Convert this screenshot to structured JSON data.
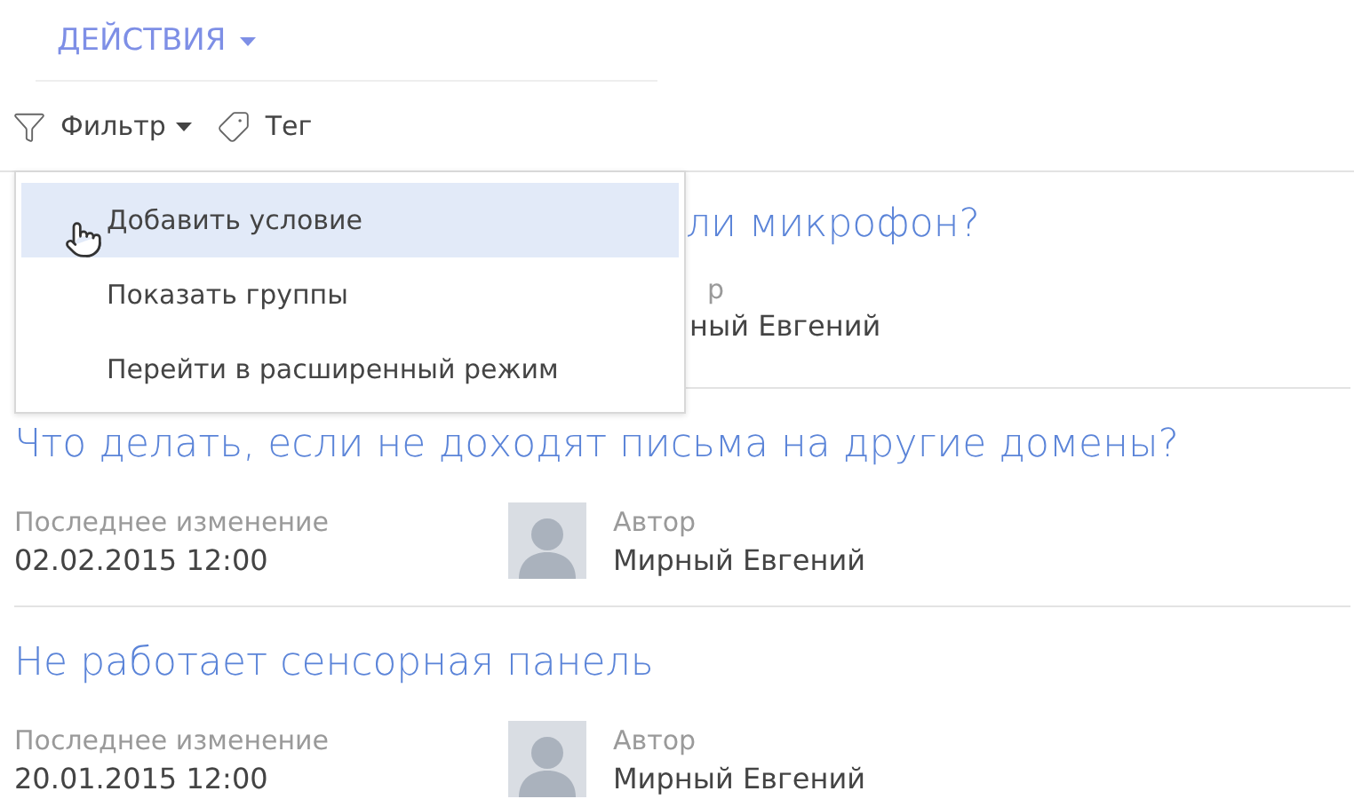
{
  "actions_menu": {
    "label": "ДЕЙСТВИЯ"
  },
  "toolbar": {
    "filter": "Фильтр",
    "tag": "Тег"
  },
  "filter_menu": {
    "items": [
      {
        "label": "Добавить условие",
        "selected": true
      },
      {
        "label": "Показать группы",
        "selected": false
      },
      {
        "label": "Перейти в расширенный режим",
        "selected": false
      }
    ]
  },
  "records": [
    {
      "kind": "covered",
      "title": "ли микрофон?",
      "author_label": "р",
      "author": "ный Евгений"
    },
    {
      "kind": "full",
      "title": "Что делать, если не доходят письма на другие домены?",
      "modified_label": "Последнее изменение",
      "modified": "02.02.2015 12:00",
      "author_label": "Автор",
      "author": "Мирный Евгений"
    },
    {
      "kind": "full",
      "title": "Не работает сенсорная панель",
      "modified_label": "Последнее изменение",
      "modified": "20.01.2015 12:00",
      "author_label": "Автор",
      "author": "Мирный Евгений"
    }
  ]
}
